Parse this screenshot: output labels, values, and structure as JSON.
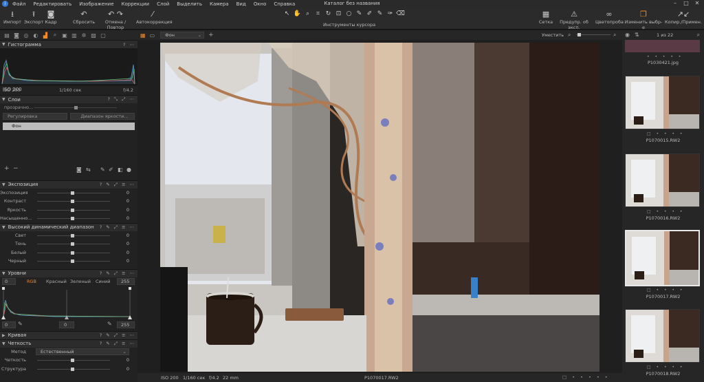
{
  "window": {
    "title": "Каталог без названия"
  },
  "menu": [
    "Файл",
    "Редактировать",
    "Изображение",
    "Коррекции",
    "Слой",
    "Выделить",
    "Камера",
    "Вид",
    "Окно",
    "Справка"
  ],
  "toolbar": {
    "import": "Импорт",
    "export": "Экспорт",
    "capture": "Кадр",
    "reset": "Сбросить",
    "undo_redo": "Отмена / Повтор",
    "autocorrect": "Автокоррекция",
    "cursor_tools": "Инструменты курсора",
    "grid": "Сетка",
    "exposure_warning": "Предупр. об эксп.",
    "proof": "Цветопроба",
    "edit_selected": "Изменить выбр-е",
    "copy_apply": "Копир./Примен."
  },
  "histogram": {
    "title": "Гистограмма",
    "iso": "ISO 200",
    "shutter": "1/160 сек",
    "aperture": "f/4.2"
  },
  "layers": {
    "title": "Слои",
    "opacity": "прозрачно...",
    "adjustment": "Регулировка",
    "brightness_range": "Диапазон яркости...",
    "background_layer": "Фон"
  },
  "exposure": {
    "title": "Экспозиция",
    "rows": [
      {
        "label": "Экспозиция",
        "value": "0"
      },
      {
        "label": "Контраст",
        "value": "0"
      },
      {
        "label": "Яркость",
        "value": "0"
      },
      {
        "label": "Насыщенно...",
        "value": "0"
      }
    ]
  },
  "hdr": {
    "title": "Высокий динамический диапазон",
    "rows": [
      {
        "label": "Свет",
        "value": "0"
      },
      {
        "label": "Тень",
        "value": "0"
      },
      {
        "label": "Белый",
        "value": "0"
      },
      {
        "label": "Черный",
        "value": "0"
      }
    ]
  },
  "levels": {
    "title": "Уровни",
    "min": "0",
    "max": "255",
    "channels": [
      "RGB",
      "Красный",
      "Зеленый",
      "Синий"
    ],
    "out_min": "0",
    "mid": "0",
    "out_max": "255"
  },
  "curve": {
    "title": "Кривая"
  },
  "clarity": {
    "title": "Четкость",
    "method_label": "Метод",
    "method_value": "Естественный",
    "rows": [
      {
        "label": "Четкость",
        "value": "0"
      },
      {
        "label": "Структура",
        "value": "0"
      }
    ]
  },
  "viewer": {
    "layer_select": "Фон",
    "fit": "Уместить",
    "count": "1 из 22",
    "status_iso": "ISO 200",
    "status_shutter": "1/160 сек",
    "status_aperture": "f/4.2",
    "status_focal": "22 mm",
    "filename": "P1070017.RW2"
  },
  "browser": {
    "items": [
      {
        "name": "P1030421.jpg"
      },
      {
        "name": "P1070015.RW2"
      },
      {
        "name": "P1070016.RW2"
      },
      {
        "name": "P1070017.RW2"
      },
      {
        "name": "P1070018.RW2"
      }
    ]
  },
  "colors": {
    "accent": "#f08a24"
  }
}
